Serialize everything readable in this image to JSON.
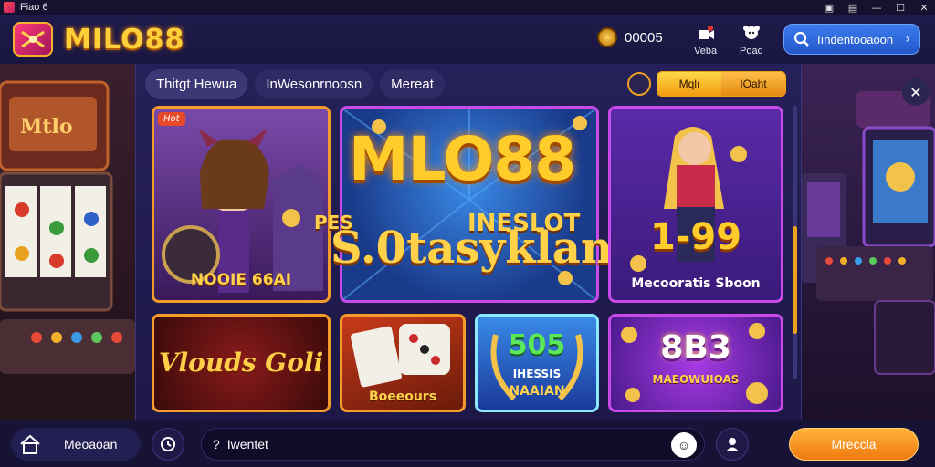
{
  "window": {
    "title": "Fiao 6",
    "controls": [
      "pin",
      "note",
      "minimize",
      "maximize",
      "close"
    ]
  },
  "header": {
    "brand": "MILO88",
    "coins": "00005",
    "buttons": [
      {
        "label": "Veba",
        "icon": "video-icon"
      },
      {
        "label": "Poad",
        "icon": "profile-icon"
      }
    ],
    "search_label": "Iındentooaoon"
  },
  "tabs": [
    {
      "label": "Thitgt Hewua",
      "active": true
    },
    {
      "label": "InWesonrnoosn",
      "active": false
    },
    {
      "label": "Mereat",
      "active": false
    }
  ],
  "filter": {
    "options": [
      "Mqlı",
      "IOaht"
    ]
  },
  "tiles": {
    "featured": {
      "badge": "Hot",
      "caption": "NOOIE 66AI"
    },
    "hero": {
      "title": "MLO88",
      "subtitle_left": "PES",
      "subtitle_right": "INESLOT",
      "line2": "S.0tasyklan"
    },
    "promo": {
      "number": "1-99",
      "caption": "Mecooratis Sboon"
    },
    "script": {
      "caption": "Vlouds Goli"
    },
    "cards": {
      "caption": "Boeeours"
    },
    "wreath": {
      "number": "505",
      "line2": "IHESSIS",
      "line3": "NAAIAN"
    },
    "slots": {
      "number": "8B3",
      "caption": "MAEOWUIOAS"
    }
  },
  "bottom": {
    "home_label": "Meoaoan",
    "input_value": "Iwentet",
    "input_prefix": "?",
    "action_label": "Mreccla"
  },
  "colors": {
    "accent": "#f6b12d",
    "primary_blue": "#3b7df0",
    "action_orange": "#f07a10",
    "panel_bg": "#26205a"
  }
}
